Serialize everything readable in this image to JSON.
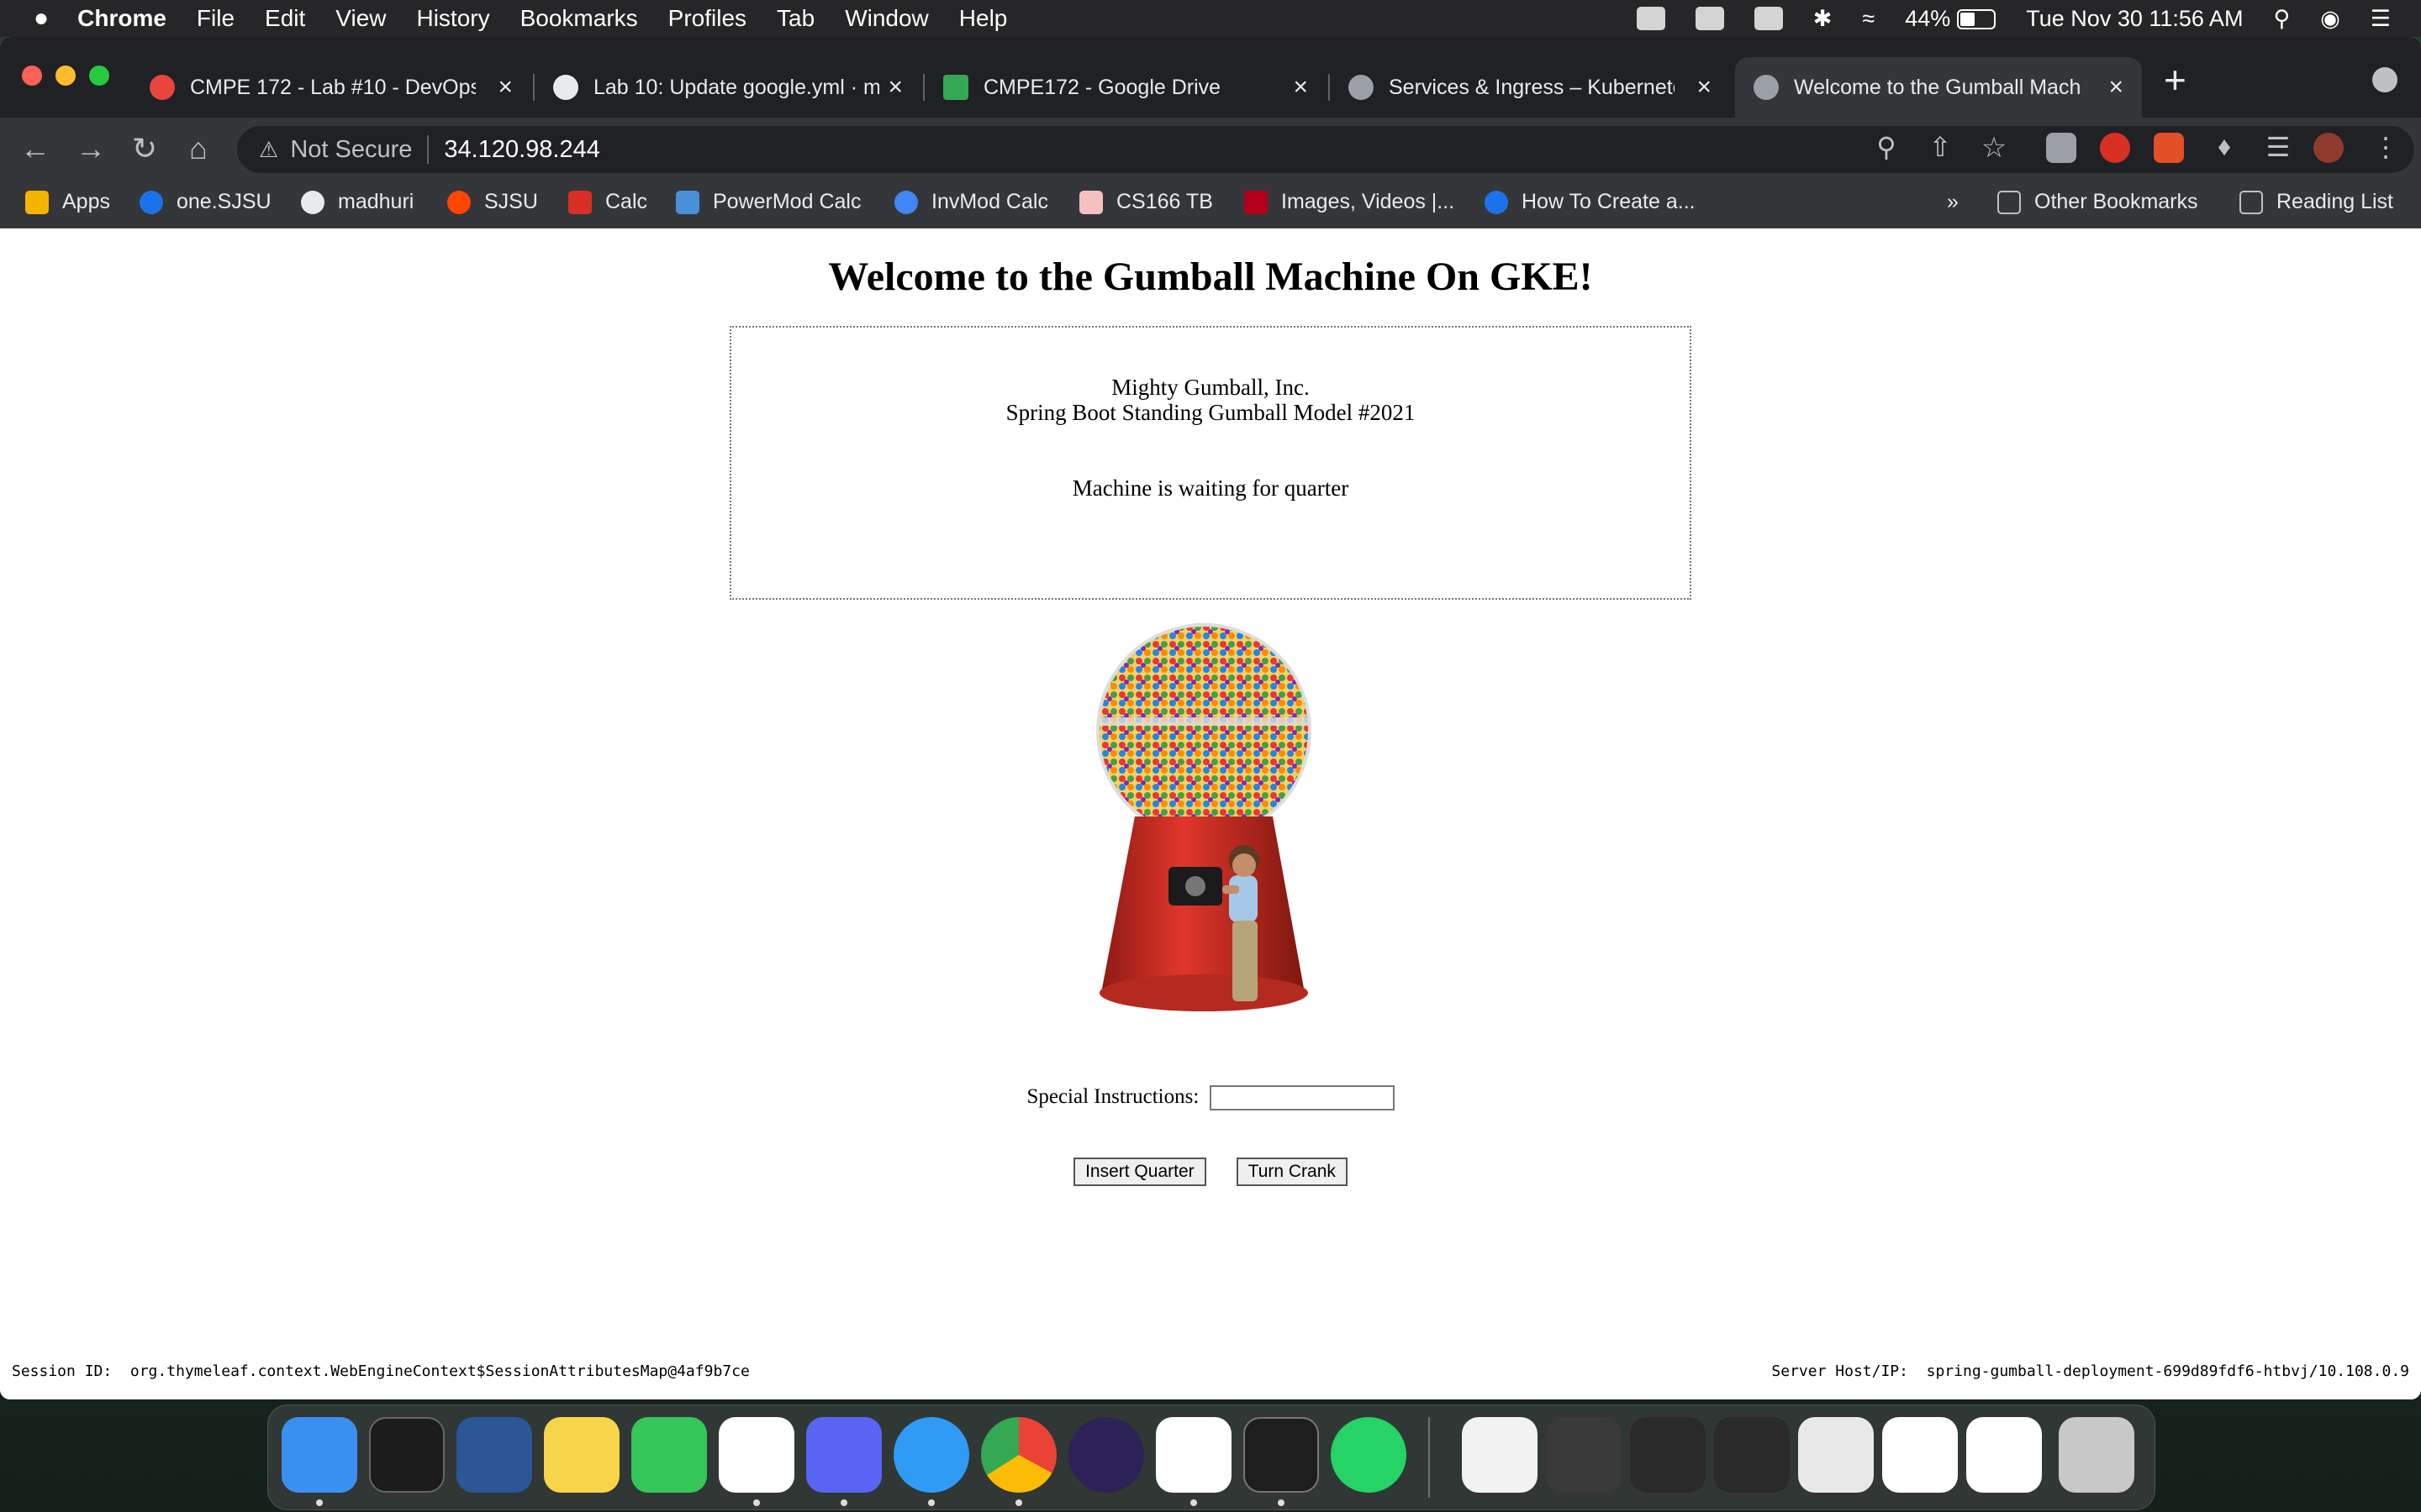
{
  "menubar": {
    "app": "Chrome",
    "items": [
      "File",
      "Edit",
      "View",
      "History",
      "Bookmarks",
      "Profiles",
      "Tab",
      "Window",
      "Help"
    ],
    "battery": "44%",
    "datetime": "Tue Nov 30  11:56 AM"
  },
  "tabs": [
    {
      "title": "CMPE 172 - Lab #10 - DevOps",
      "color": "#e8453c"
    },
    {
      "title": "Lab 10: Update google.yml · m",
      "color": "#e8eaed"
    },
    {
      "title": "CMPE172 - Google Drive",
      "color": "#34a853"
    },
    {
      "title": "Services & Ingress – Kubernete",
      "color": "#9aa0a6"
    },
    {
      "title": "Welcome to the Gumball Machi",
      "color": "#9aa0a6"
    }
  ],
  "omnibox": {
    "security": "Not Secure",
    "url": "34.120.98.244"
  },
  "bookmarks": {
    "items": [
      {
        "label": "Apps",
        "color": "#f4b400"
      },
      {
        "label": "one.SJSU",
        "color": "#1a73e8"
      },
      {
        "label": "madhuri",
        "color": "#e8eaed"
      },
      {
        "label": "SJSU",
        "color": "#ff4500"
      },
      {
        "label": "Calc",
        "color": "#d93025"
      },
      {
        "label": "PowerMod Calc",
        "color": "#4a90d9"
      },
      {
        "label": "InvMod Calc",
        "color": "#4285f4"
      },
      {
        "label": "CS166 TB",
        "color": "#f6c0c0"
      },
      {
        "label": "Images, Videos |...",
        "color": "#b3001b"
      },
      {
        "label": "How To Create a...",
        "color": "#1a73e8"
      }
    ],
    "overflow": "»",
    "other": "Other Bookmarks",
    "reading": "Reading List"
  },
  "page": {
    "heading": "Welcome to the Gumball Machine On GKE!",
    "company": "Mighty Gumball, Inc.",
    "model": "Spring Boot Standing Gumball Model #2021",
    "state": "Machine is waiting for quarter",
    "instructions_label": "Special Instructions:",
    "instructions_value": "",
    "insert_label": "Insert Quarter",
    "crank_label": "Turn Crank",
    "session": "Session ID:  org.thymeleaf.context.WebEngineContext$SessionAttributesMap@4af9b7ce",
    "server": "Server Host/IP:  spring-gumball-deployment-699d89fdf6-htbvj/10.108.0.9"
  },
  "dock": [
    {
      "name": "finder",
      "color": "#3b8ff0"
    },
    {
      "name": "activity-monitor",
      "color": "#1c1c1c"
    },
    {
      "name": "word",
      "color": "#2b5797"
    },
    {
      "name": "notes",
      "color": "#f7d54a"
    },
    {
      "name": "facetime",
      "color": "#35c759"
    },
    {
      "name": "slack",
      "color": "#ffffff"
    },
    {
      "name": "discord",
      "color": "#5865f2"
    },
    {
      "name": "messages",
      "color": "#2f9bf5"
    },
    {
      "name": "chrome",
      "color": "#ffffff"
    },
    {
      "name": "eclipse",
      "color": "#2c2255"
    },
    {
      "name": "vscode",
      "color": "#ffffff"
    },
    {
      "name": "terminal",
      "color": "#1e1e1e"
    },
    {
      "name": "whatsapp",
      "color": "#25d366"
    }
  ]
}
